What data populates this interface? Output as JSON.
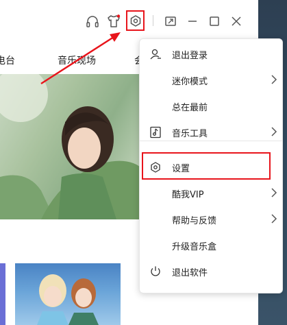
{
  "tabs": [
    "电台",
    "音乐现场",
    "会"
  ],
  "menu": {
    "items": [
      {
        "label": "退出登录",
        "icon": "logout-user-icon",
        "submenu": false
      },
      {
        "label": "迷你模式",
        "icon": "",
        "submenu": true
      },
      {
        "label": "总在最前",
        "icon": "",
        "submenu": false
      },
      {
        "label": "音乐工具",
        "icon": "music-tools-icon",
        "submenu": true
      },
      {
        "label": "设置",
        "icon": "settings-gear-icon",
        "submenu": false
      },
      {
        "label": "酷我VIP",
        "icon": "",
        "submenu": true
      },
      {
        "label": "帮助与反馈",
        "icon": "",
        "submenu": true
      },
      {
        "label": "升级音乐盒",
        "icon": "",
        "submenu": false
      },
      {
        "label": "退出软件",
        "icon": "power-icon",
        "submenu": false
      }
    ]
  },
  "colors": {
    "highlight_red": "#e8141b",
    "right_strip": "#324a5f",
    "accent_purple": "#6a6fd6"
  }
}
